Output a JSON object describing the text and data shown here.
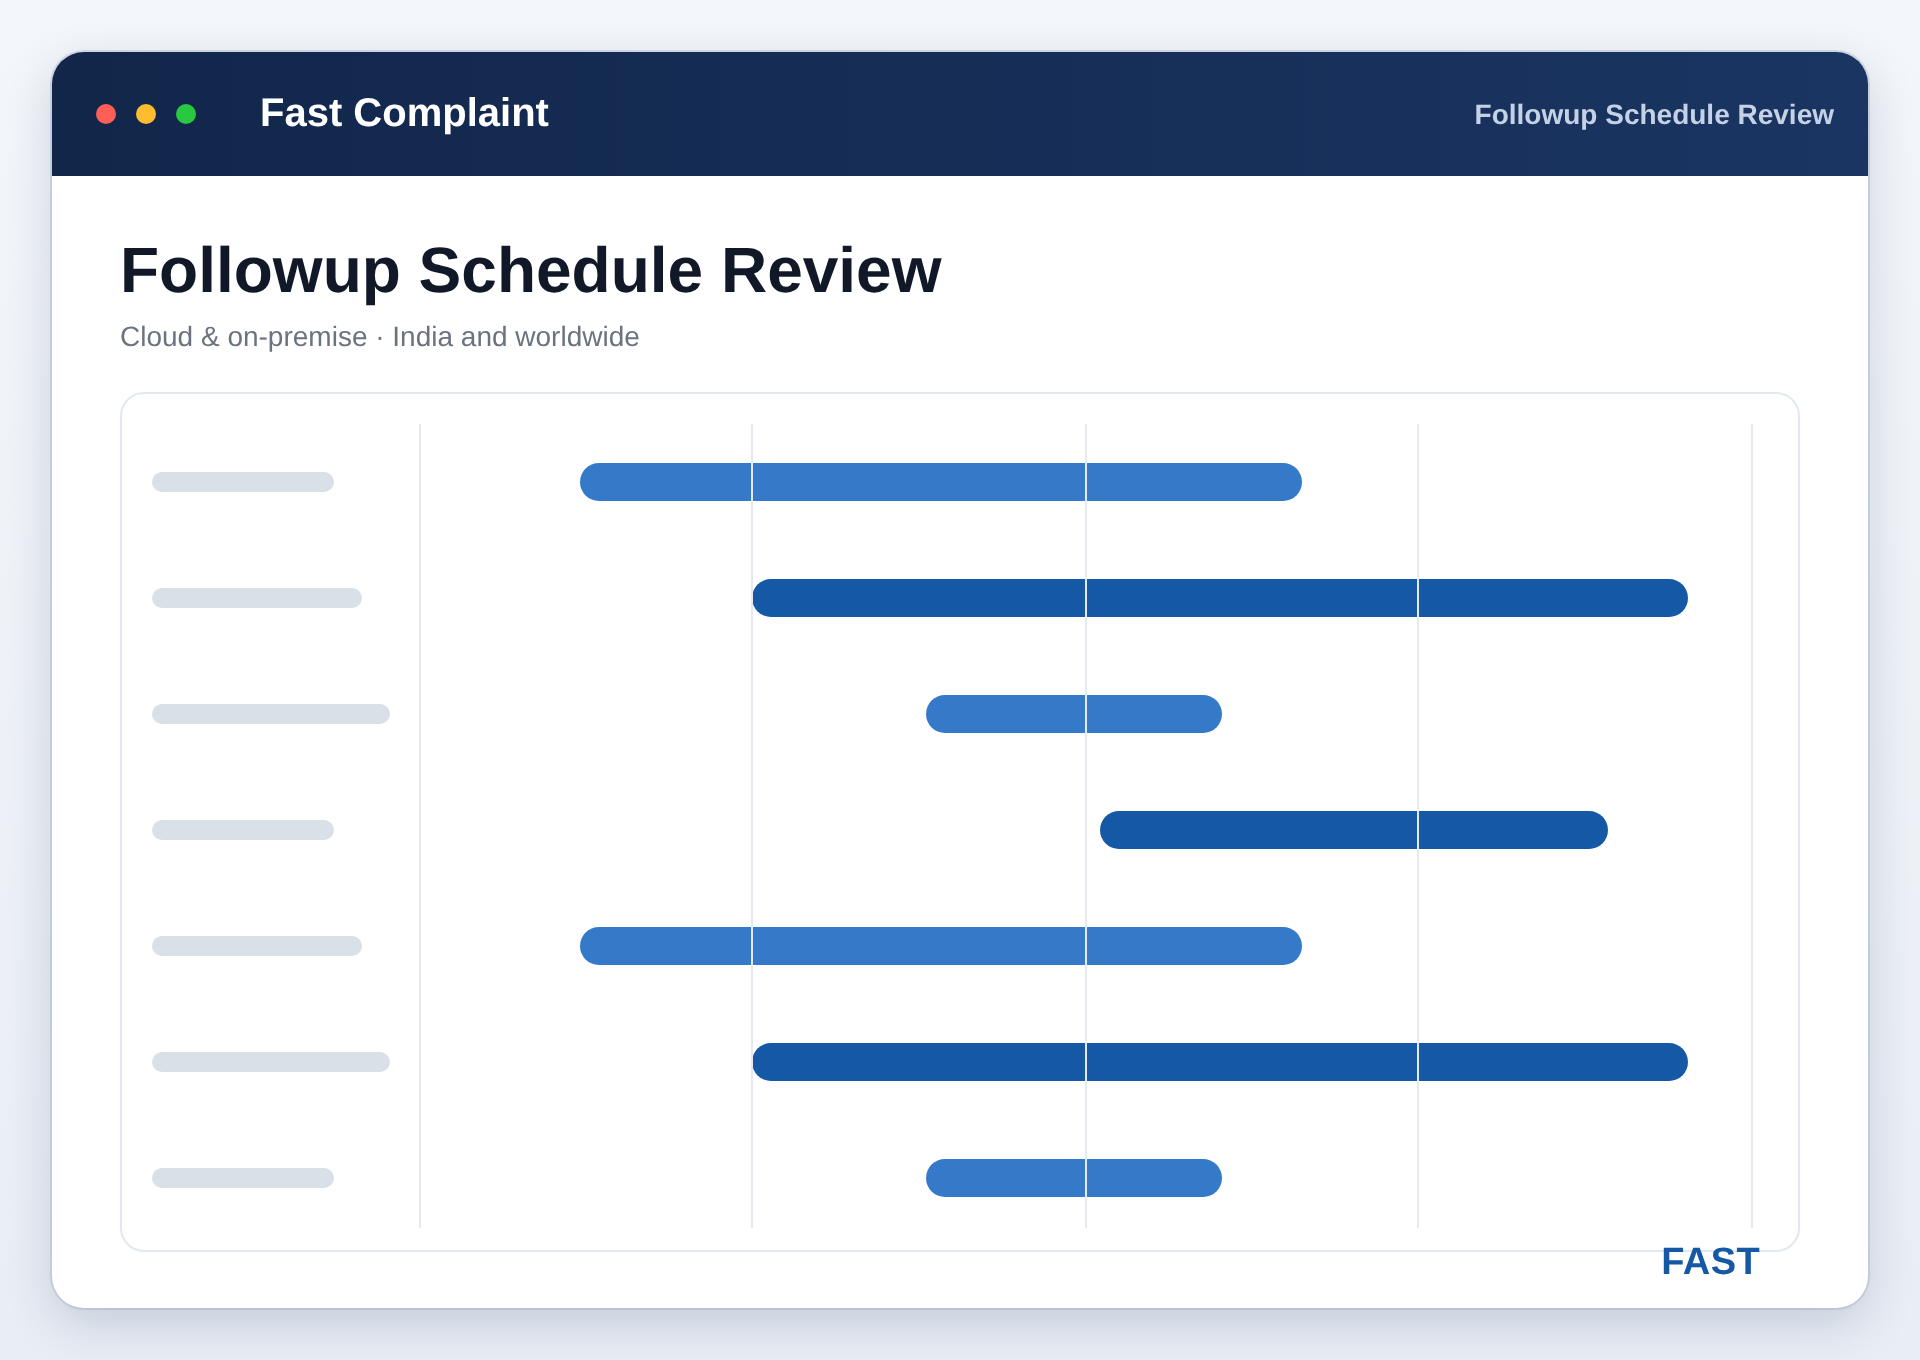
{
  "window": {
    "app_name": "Fast Complaint",
    "page_name": "Followup Schedule Review"
  },
  "page": {
    "title": "Followup Schedule Review",
    "subtitle": "Cloud & on-premise · India and worldwide"
  },
  "footer": {
    "logo": "FAST"
  }
}
